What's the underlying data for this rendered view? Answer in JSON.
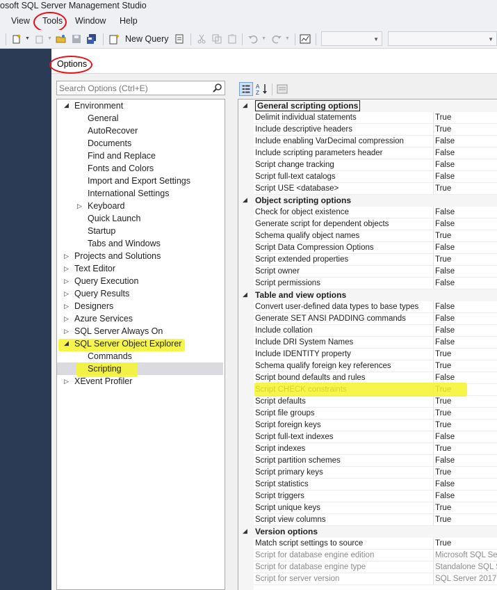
{
  "window": {
    "title": "osoft SQL Server Management Studio"
  },
  "menu": {
    "items": [
      "View",
      "Tools",
      "Window",
      "Help"
    ]
  },
  "toolbar": {
    "new_query_label": "New Query"
  },
  "dialog": {
    "title": "Options"
  },
  "search": {
    "placeholder": "Search Options (Ctrl+E)"
  },
  "tree": {
    "items": [
      {
        "label": "Environment",
        "level": 0,
        "arrow": "◢"
      },
      {
        "label": "General",
        "level": 1,
        "arrow": ""
      },
      {
        "label": "AutoRecover",
        "level": 1,
        "arrow": ""
      },
      {
        "label": "Documents",
        "level": 1,
        "arrow": ""
      },
      {
        "label": "Find and Replace",
        "level": 1,
        "arrow": ""
      },
      {
        "label": "Fonts and Colors",
        "level": 1,
        "arrow": ""
      },
      {
        "label": "Import and Export Settings",
        "level": 1,
        "arrow": ""
      },
      {
        "label": "International Settings",
        "level": 1,
        "arrow": ""
      },
      {
        "label": "Keyboard",
        "level": 1,
        "arrow": "▷"
      },
      {
        "label": "Quick Launch",
        "level": 1,
        "arrow": ""
      },
      {
        "label": "Startup",
        "level": 1,
        "arrow": ""
      },
      {
        "label": "Tabs and Windows",
        "level": 1,
        "arrow": ""
      },
      {
        "label": "Projects and Solutions",
        "level": 0,
        "arrow": "▷"
      },
      {
        "label": "Text Editor",
        "level": 0,
        "arrow": "▷"
      },
      {
        "label": "Query Execution",
        "level": 0,
        "arrow": "▷"
      },
      {
        "label": "Query Results",
        "level": 0,
        "arrow": "▷"
      },
      {
        "label": "Designers",
        "level": 0,
        "arrow": "▷"
      },
      {
        "label": "Azure Services",
        "level": 0,
        "arrow": "▷"
      },
      {
        "label": "SQL Server Always On",
        "level": 0,
        "arrow": "▷"
      },
      {
        "label": "SQL Server Object Explorer",
        "level": 0,
        "arrow": "◢"
      },
      {
        "label": "Commands",
        "level": 1,
        "arrow": ""
      },
      {
        "label": "Scripting",
        "level": 1,
        "arrow": ""
      },
      {
        "label": "XEvent Profiler",
        "level": 0,
        "arrow": "▷"
      }
    ]
  },
  "grid": {
    "rows": [
      {
        "kind": "cat",
        "name": "General scripting options"
      },
      {
        "kind": "prop",
        "name": "Delimit individual statements",
        "value": "True"
      },
      {
        "kind": "prop",
        "name": "Include descriptive headers",
        "value": "True"
      },
      {
        "kind": "prop",
        "name": "Include enabling VarDecimal compression",
        "value": "False"
      },
      {
        "kind": "prop",
        "name": "Include scripting parameters header",
        "value": "False"
      },
      {
        "kind": "prop",
        "name": "Script change tracking",
        "value": "False"
      },
      {
        "kind": "prop",
        "name": "Script full-text catalogs",
        "value": "False"
      },
      {
        "kind": "prop",
        "name": "Script USE <database>",
        "value": "True"
      },
      {
        "kind": "cat",
        "name": "Object scripting options"
      },
      {
        "kind": "prop",
        "name": "Check for object existence",
        "value": "False"
      },
      {
        "kind": "prop",
        "name": "Generate script for dependent objects",
        "value": "False"
      },
      {
        "kind": "prop",
        "name": "Schema qualify object names",
        "value": "True"
      },
      {
        "kind": "prop",
        "name": "Script Data Compression Options",
        "value": "False"
      },
      {
        "kind": "prop",
        "name": "Script extended properties",
        "value": "True"
      },
      {
        "kind": "prop",
        "name": "Script owner",
        "value": "False"
      },
      {
        "kind": "prop",
        "name": "Script permissions",
        "value": "False"
      },
      {
        "kind": "cat",
        "name": "Table and view options"
      },
      {
        "kind": "prop",
        "name": "Convert user-defined data types to base types",
        "value": "False"
      },
      {
        "kind": "prop",
        "name": "Generate SET ANSI PADDING commands",
        "value": "False"
      },
      {
        "kind": "prop",
        "name": "Include collation",
        "value": "False"
      },
      {
        "kind": "prop",
        "name": "Include DRI System Names",
        "value": "False"
      },
      {
        "kind": "prop",
        "name": "Include IDENTITY property",
        "value": "True"
      },
      {
        "kind": "prop",
        "name": "Schema qualify foreign key references",
        "value": "True"
      },
      {
        "kind": "prop",
        "name": "Script bound defaults and rules",
        "value": "False"
      },
      {
        "kind": "prop",
        "name": "Script CHECK constraints",
        "value": "True"
      },
      {
        "kind": "prop",
        "name": "Script defaults",
        "value": "True"
      },
      {
        "kind": "prop",
        "name": "Script file groups",
        "value": "True"
      },
      {
        "kind": "prop",
        "name": "Script foreign keys",
        "value": "True"
      },
      {
        "kind": "prop",
        "name": "Script full-text indexes",
        "value": "False"
      },
      {
        "kind": "prop",
        "name": "Script indexes",
        "value": "True"
      },
      {
        "kind": "prop",
        "name": "Script partition schemes",
        "value": "False"
      },
      {
        "kind": "prop",
        "name": "Script primary keys",
        "value": "True"
      },
      {
        "kind": "prop",
        "name": "Script statistics",
        "value": "False"
      },
      {
        "kind": "prop",
        "name": "Script triggers",
        "value": "False"
      },
      {
        "kind": "prop",
        "name": "Script unique keys",
        "value": "True"
      },
      {
        "kind": "prop",
        "name": "Script view columns",
        "value": "True"
      },
      {
        "kind": "cat",
        "name": "Version options"
      },
      {
        "kind": "prop",
        "name": "Match script settings to source",
        "value": "True"
      },
      {
        "kind": "prop",
        "name": "Script for database engine edition",
        "value": "Microsoft SQL Serv",
        "dim": true
      },
      {
        "kind": "prop",
        "name": "Script for database engine type",
        "value": "Standalone SQL Se",
        "dim": true
      },
      {
        "kind": "prop",
        "name": "Script for server version",
        "value": "SQL Server 2017",
        "dim": true
      }
    ]
  },
  "colors": {
    "highlight": "#f5f52a",
    "annotation_red": "#e8101a",
    "dark_bg": "#2b3a55"
  }
}
